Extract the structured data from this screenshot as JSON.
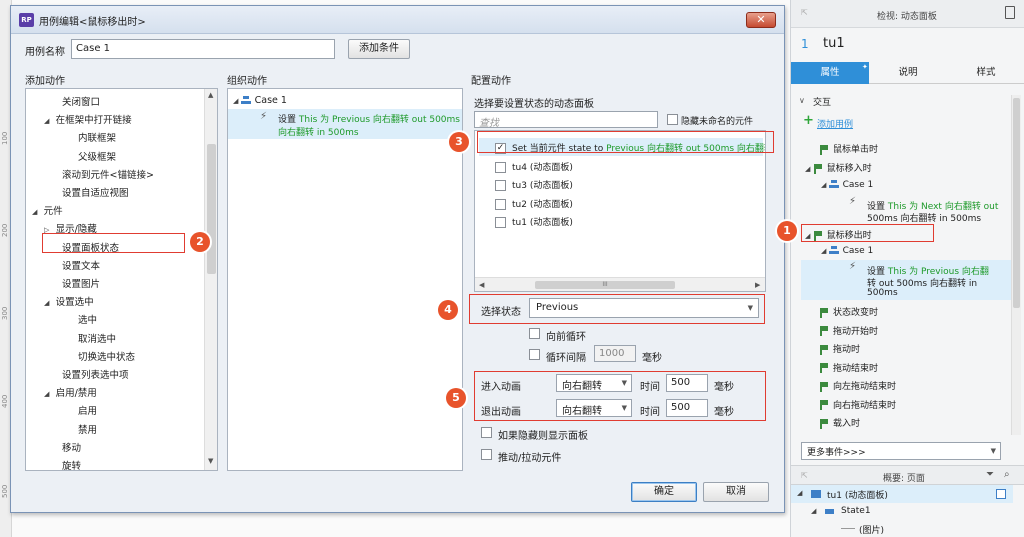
{
  "ruler": {
    "marks": [
      "100",
      "200",
      "300",
      "400",
      "500"
    ]
  },
  "dialog": {
    "app_icon": "RP",
    "title": "用例编辑<鼠标移出时>",
    "close_symbol": "✕",
    "case_name_label": "用例名称",
    "case_name_value": "Case 1",
    "add_condition_btn": "添加条件",
    "col_add_action": "添加动作",
    "col_organize_action": "组织动作",
    "col_config_action": "配置动作",
    "actions": [
      {
        "label": "关闭窗口",
        "indent": 2
      },
      {
        "label": "在框架中打开链接",
        "indent": 1,
        "expanded": true
      },
      {
        "label": "内联框架",
        "indent": 3
      },
      {
        "label": "父级框架",
        "indent": 3
      },
      {
        "label": "滚动到元件<锚链接>",
        "indent": 2
      },
      {
        "label": "设置自适应视图",
        "indent": 2
      },
      {
        "label": "元件",
        "indent": 0,
        "expanded": true
      },
      {
        "label": "显示/隐藏",
        "indent": 1,
        "collapsed": true
      },
      {
        "label": "设置面板状态",
        "indent": 2
      },
      {
        "label": "设置文本",
        "indent": 2
      },
      {
        "label": "设置图片",
        "indent": 2
      },
      {
        "label": "设置选中",
        "indent": 1,
        "expanded": true
      },
      {
        "label": "选中",
        "indent": 3
      },
      {
        "label": "取消选中",
        "indent": 3
      },
      {
        "label": "切换选中状态",
        "indent": 3
      },
      {
        "label": "设置列表选中项",
        "indent": 2
      },
      {
        "label": "启用/禁用",
        "indent": 1,
        "expanded": true
      },
      {
        "label": "启用",
        "indent": 3
      },
      {
        "label": "禁用",
        "indent": 3
      },
      {
        "label": "移动",
        "indent": 2
      },
      {
        "label": "旋转",
        "indent": 2
      }
    ],
    "organize": {
      "case_label": "Case 1",
      "action_prefix": "设置 ",
      "action_line1": "This 为 Previous 向右翻转 out 500ms",
      "action_line2": "向右翻转 in 500ms"
    },
    "config": {
      "panel_select_label": "选择要设置状态的动态面板",
      "search_placeholder": "查找",
      "hide_unnamed_label": "隐藏未命名的元件",
      "items": [
        {
          "prefix": "Set 当前元件 state to ",
          "green": "Previous 向右翻转 out 500ms 向右翻转",
          "checked": true
        },
        {
          "prefix": "tu4 (动态面板)",
          "green": "",
          "checked": false
        },
        {
          "prefix": "tu3 (动态面板)",
          "green": "",
          "checked": false
        },
        {
          "prefix": "tu2 (动态面板)",
          "green": "",
          "checked": false
        },
        {
          "prefix": "tu1 (动态面板)",
          "green": "",
          "checked": false
        }
      ],
      "hscroll_grip": "III",
      "select_state_label": "选择状态",
      "select_state_value": "Previous",
      "loop_forward_label": "向前循环",
      "loop_interval_label": "循环间隔",
      "loop_interval_value": "1000",
      "ms_label": "毫秒",
      "enter_anim_label": "进入动画",
      "enter_anim_value": "向右翻转",
      "time_label": "时间",
      "enter_time_value": "500",
      "exit_anim_label": "退出动画",
      "exit_anim_value": "向右翻转",
      "exit_time_value": "500",
      "show_if_hidden_label": "如果隐藏则显示面板",
      "push_pull_label": "推动/拉动元件"
    },
    "ok_btn": "确定",
    "cancel_btn": "取消"
  },
  "badges": [
    "1",
    "2",
    "3",
    "4",
    "5"
  ],
  "right_panel": {
    "header_title": "检视: 动态面板",
    "element_index": "1",
    "element_name": "tu1",
    "tabs": [
      "属性",
      "说明",
      "样式"
    ],
    "section_interaction": "交互",
    "add_case_plus": "+",
    "add_case": "添加用例",
    "click_event": "鼠标单击时",
    "mouse_enter_event": "鼠标移入时",
    "enter_case": "Case 1",
    "enter_action_prefix": "设置 ",
    "enter_action_line1": "This 为 Next 向右翻转 out",
    "enter_action_line2": "500ms 向右翻转 in 500ms",
    "mouse_leave_event": "鼠标移出时",
    "leave_case": "Case 1",
    "leave_action_prefix": "设置 ",
    "leave_action_line1": "This 为 Previous 向右翻",
    "leave_action_line2": "转 out 500ms 向右翻转 in",
    "leave_action_line3": "500ms",
    "other_events": [
      "状态改变时",
      "拖动开始时",
      "拖动时",
      "拖动结束时",
      "向左拖动结束时",
      "向右拖动结束时",
      "载入时"
    ],
    "more_events": "更多事件>>>",
    "outline_title": "概要: 页面",
    "outline_item1": "tu1 (动态面板)",
    "outline_item2": "State1",
    "outline_item3": "(图片)"
  },
  "colors": {
    "accent_blue": "#2f8fd8",
    "badge_red": "#e8532b",
    "action_green": "#1e9a2a"
  }
}
